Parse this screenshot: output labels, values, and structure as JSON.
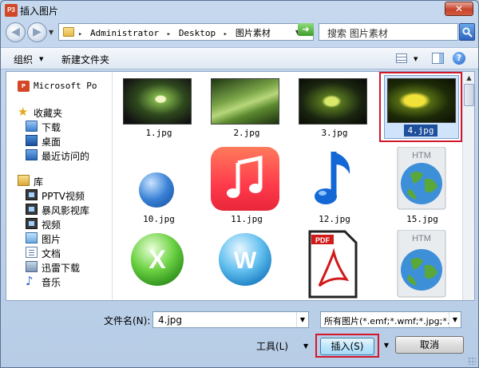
{
  "window": {
    "title": "插入图片",
    "app_icon_text": "P3",
    "close_label": "✕"
  },
  "navigation": {
    "breadcrumbs": [
      "Administrator",
      "Desktop",
      "图片素材"
    ],
    "search_placeholder": "搜索 图片素材"
  },
  "toolbar": {
    "organize_label": "组织",
    "new_folder_label": "新建文件夹"
  },
  "sidebar": {
    "items": [
      {
        "label": "Microsoft Po",
        "icon": "powerpoint-icon"
      },
      {
        "label": "收藏夹",
        "icon": "star-icon"
      },
      {
        "label": "下载",
        "icon": "downloads-folder-icon"
      },
      {
        "label": "桌面",
        "icon": "desktop-icon"
      },
      {
        "label": "最近访问的",
        "icon": "recent-places-icon"
      },
      {
        "label": "库",
        "icon": "library-icon"
      },
      {
        "label": "PPTV视频",
        "icon": "video-library-icon"
      },
      {
        "label": "暴风影视库",
        "icon": "video-library-icon"
      },
      {
        "label": "视频",
        "icon": "video-icon"
      },
      {
        "label": "图片",
        "icon": "pictures-icon"
      },
      {
        "label": "文档",
        "icon": "documents-icon"
      },
      {
        "label": "迅雷下载",
        "icon": "thunder-download-icon"
      },
      {
        "label": "音乐",
        "icon": "music-icon"
      }
    ]
  },
  "files": [
    {
      "name": "1.jpg",
      "kind": "photo"
    },
    {
      "name": "2.jpg",
      "kind": "photo"
    },
    {
      "name": "3.jpg",
      "kind": "photo"
    },
    {
      "name": "4.jpg",
      "kind": "photo",
      "selected": true
    },
    {
      "name": "10.jpg",
      "kind": "ie-icon"
    },
    {
      "name": "11.jpg",
      "kind": "music-app-icon"
    },
    {
      "name": "12.jpg",
      "kind": "music-note-icon"
    },
    {
      "name": "15.jpg",
      "kind": "htm-globe-icon"
    },
    {
      "name": "",
      "kind": "excel-icon"
    },
    {
      "name": "",
      "kind": "word-icon"
    },
    {
      "name": "",
      "kind": "pdf-icon"
    },
    {
      "name": "",
      "kind": "htm-globe-icon"
    }
  ],
  "htm_label": "HTM",
  "pdf_label": "PDF",
  "bottom": {
    "filename_label": "文件名(N):",
    "filename_value": "4.jpg",
    "filetype_value": "所有图片(*.emf;*.wmf;*.jpg;*.jr",
    "tools_label": "工具(L)",
    "insert_label": "插入(S)",
    "cancel_label": "取消"
  },
  "colors": {
    "highlight_red": "#d0182a",
    "selection_blue": "#1e4f9b"
  }
}
